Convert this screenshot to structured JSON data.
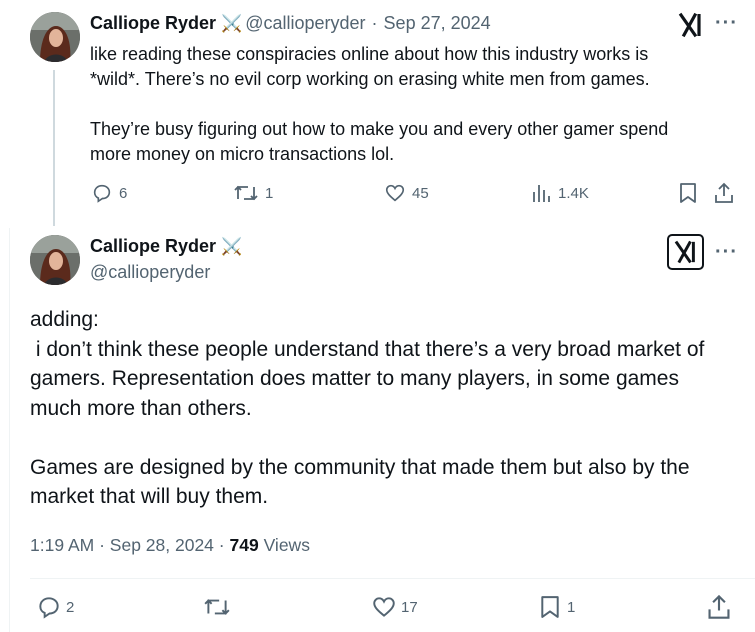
{
  "post1": {
    "author_name": "Calliope Ryder",
    "author_emoji": "⚔️",
    "handle": "@callioperyder",
    "separator": "·",
    "date": "Sep 27, 2024",
    "lines": [
      "like reading these conspiracies online about how this industry works is",
      "*wild*. There’s no evil corp working on erasing white men from games.",
      "",
      "They’re busy figuring out how to make you and every other gamer spend",
      "more money on micro transactions lol."
    ],
    "actions": {
      "replies": "6",
      "reposts": "1",
      "likes": "45",
      "views": "1.4K"
    }
  },
  "post2": {
    "author_name": "Calliope Ryder",
    "author_emoji": "⚔️",
    "handle": "@callioperyder",
    "lines": [
      "adding:",
      " i don’t think these people understand that there’s a very broad market of",
      "gamers. Representation does matter to many players, in some games",
      "much more than others.",
      "",
      "Games are designed by the community that made them but also by the",
      "market that will buy them."
    ],
    "time": "1:19 AM",
    "date": "Sep 28, 2024",
    "views_count": "749",
    "views_label": "Views",
    "actions": {
      "replies": "2",
      "likes": "17",
      "bookmarks": "1"
    }
  },
  "dots_label": "···",
  "colors": {
    "text": "#0f1419",
    "muted": "#536471",
    "thread_line": "#cfd9de",
    "divider": "#eff3f4"
  },
  "icons": [
    "x-logo-icon",
    "more-icon",
    "reply-icon",
    "repost-icon",
    "like-icon",
    "views-icon",
    "bookmark-icon",
    "share-icon",
    "avatar"
  ]
}
